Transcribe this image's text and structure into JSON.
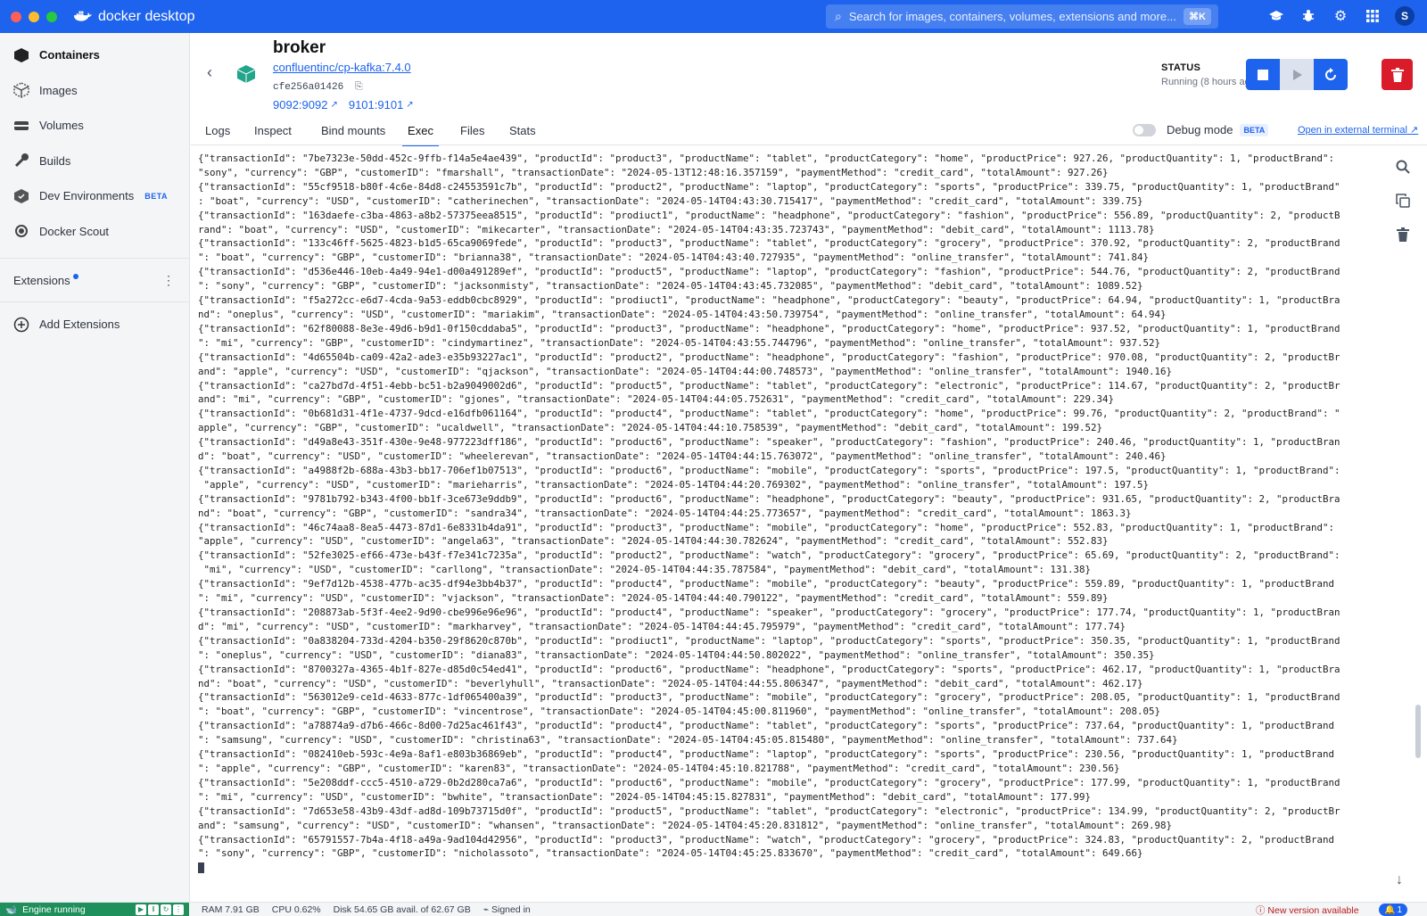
{
  "app": {
    "title": "docker desktop",
    "colors": {
      "brand": "#1d63ed",
      "danger": "#d91b2a",
      "running": "#1f8f5c"
    }
  },
  "search": {
    "placeholder": "Search for images, containers, volumes, extensions and more...",
    "shortcut": "⌘K"
  },
  "account": {
    "initial": "S"
  },
  "sidebar": {
    "items": [
      {
        "label": "Containers",
        "icon": "containers-icon",
        "active": true
      },
      {
        "label": "Images",
        "icon": "images-icon"
      },
      {
        "label": "Volumes",
        "icon": "volumes-icon"
      },
      {
        "label": "Builds",
        "icon": "builds-icon"
      },
      {
        "label": "Dev Environments",
        "icon": "dev-environments-icon",
        "badge": "BETA"
      },
      {
        "label": "Docker Scout",
        "icon": "docker-scout-icon"
      }
    ],
    "extensions_label": "Extensions",
    "add_extensions_label": "Add Extensions"
  },
  "container": {
    "name": "broker",
    "image": "confluentinc/cp-kafka:7.4.0",
    "id": "cfe256a01426",
    "ports": [
      "9092:9092",
      "9101:9101"
    ],
    "status_label": "STATUS",
    "status_value": "Running (8 hours ago)"
  },
  "tabs": [
    {
      "label": "Logs"
    },
    {
      "label": "Inspect"
    },
    {
      "label": "Bind mounts"
    },
    {
      "label": "Exec",
      "active": true
    },
    {
      "label": "Files"
    },
    {
      "label": "Stats"
    }
  ],
  "debug": {
    "label": "Debug mode",
    "badge": "BETA",
    "external_terminal": "Open in external terminal"
  },
  "terminal": {
    "lines": [
      "{\"transactionId\": \"7be7323e-50dd-452c-9ffb-f14a5e4ae439\", \"productId\": \"product3\", \"productName\": \"tablet\", \"productCategory\": \"home\", \"productPrice\": 927.26, \"productQuantity\": 1, \"productBrand\":",
      "\"sony\", \"currency\": \"GBP\", \"customerID\": \"fmarshall\", \"transactionDate\": \"2024-05-13T12:48:16.357159\", \"paymentMethod\": \"credit_card\", \"totalAmount\": 927.26}",
      "{\"transactionId\": \"55cf9518-b80f-4c6e-84d8-c24553591c7b\", \"productId\": \"product2\", \"productName\": \"laptop\", \"productCategory\": \"sports\", \"productPrice\": 339.75, \"productQuantity\": 1, \"productBrand\"",
      ": \"boat\", \"currency\": \"USD\", \"customerID\": \"catherinechen\", \"transactionDate\": \"2024-05-14T04:43:30.715417\", \"paymentMethod\": \"credit_card\", \"totalAmount\": 339.75}",
      "{\"transactionId\": \"163daefe-c3ba-4863-a8b2-57375eea8515\", \"productId\": \"prodiuct1\", \"productName\": \"headphone\", \"productCategory\": \"fashion\", \"productPrice\": 556.89, \"productQuantity\": 2, \"productB",
      "rand\": \"boat\", \"currency\": \"USD\", \"customerID\": \"mikecarter\", \"transactionDate\": \"2024-05-14T04:43:35.723743\", \"paymentMethod\": \"debit_card\", \"totalAmount\": 1113.78}",
      "{\"transactionId\": \"133c46ff-5625-4823-b1d5-65ca9069fede\", \"productId\": \"product3\", \"productName\": \"tablet\", \"productCategory\": \"grocery\", \"productPrice\": 370.92, \"productQuantity\": 2, \"productBrand",
      "\": \"boat\", \"currency\": \"GBP\", \"customerID\": \"brianna38\", \"transactionDate\": \"2024-05-14T04:43:40.727935\", \"paymentMethod\": \"online_transfer\", \"totalAmount\": 741.84}",
      "{\"transactionId\": \"d536e446-10eb-4a49-94e1-d00a491289ef\", \"productId\": \"product5\", \"productName\": \"laptop\", \"productCategory\": \"fashion\", \"productPrice\": 544.76, \"productQuantity\": 2, \"productBrand",
      "\": \"sony\", \"currency\": \"GBP\", \"customerID\": \"jacksonmisty\", \"transactionDate\": \"2024-05-14T04:43:45.732085\", \"paymentMethod\": \"debit_card\", \"totalAmount\": 1089.52}",
      "{\"transactionId\": \"f5a272cc-e6d7-4cda-9a53-eddb0cbc8929\", \"productId\": \"prodiuct1\", \"productName\": \"headphone\", \"productCategory\": \"beauty\", \"productPrice\": 64.94, \"productQuantity\": 1, \"productBra",
      "nd\": \"oneplus\", \"currency\": \"USD\", \"customerID\": \"mariakim\", \"transactionDate\": \"2024-05-14T04:43:50.739754\", \"paymentMethod\": \"online_transfer\", \"totalAmount\": 64.94}",
      "{\"transactionId\": \"62f80088-8e3e-49d6-b9d1-0f150cddaba5\", \"productId\": \"product3\", \"productName\": \"headphone\", \"productCategory\": \"home\", \"productPrice\": 937.52, \"productQuantity\": 1, \"productBrand",
      "\": \"mi\", \"currency\": \"GBP\", \"customerID\": \"cindymartinez\", \"transactionDate\": \"2024-05-14T04:43:55.744796\", \"paymentMethod\": \"online_transfer\", \"totalAmount\": 937.52}",
      "{\"transactionId\": \"4d65504b-ca09-42a2-ade3-e35b93227ac1\", \"productId\": \"product2\", \"productName\": \"headphone\", \"productCategory\": \"fashion\", \"productPrice\": 970.08, \"productQuantity\": 2, \"productBr",
      "and\": \"apple\", \"currency\": \"USD\", \"customerID\": \"qjackson\", \"transactionDate\": \"2024-05-14T04:44:00.748573\", \"paymentMethod\": \"online_transfer\", \"totalAmount\": 1940.16}",
      "{\"transactionId\": \"ca27bd7d-4f51-4ebb-bc51-b2a9049002d6\", \"productId\": \"product5\", \"productName\": \"tablet\", \"productCategory\": \"electronic\", \"productPrice\": 114.67, \"productQuantity\": 2, \"productBr",
      "and\": \"mi\", \"currency\": \"GBP\", \"customerID\": \"gjones\", \"transactionDate\": \"2024-05-14T04:44:05.752631\", \"paymentMethod\": \"credit_card\", \"totalAmount\": 229.34}",
      "{\"transactionId\": \"0b681d31-4f1e-4737-9dcd-e16dfb061164\", \"productId\": \"product4\", \"productName\": \"tablet\", \"productCategory\": \"home\", \"productPrice\": 99.76, \"productQuantity\": 2, \"productBrand\": \"",
      "apple\", \"currency\": \"GBP\", \"customerID\": \"ucaldwell\", \"transactionDate\": \"2024-05-14T04:44:10.758539\", \"paymentMethod\": \"debit_card\", \"totalAmount\": 199.52}",
      "{\"transactionId\": \"d49a8e43-351f-430e-9e48-977223dff186\", \"productId\": \"product6\", \"productName\": \"speaker\", \"productCategory\": \"fashion\", \"productPrice\": 240.46, \"productQuantity\": 1, \"productBran",
      "d\": \"boat\", \"currency\": \"USD\", \"customerID\": \"wheelerevan\", \"transactionDate\": \"2024-05-14T04:44:15.763072\", \"paymentMethod\": \"online_transfer\", \"totalAmount\": 240.46}",
      "{\"transactionId\": \"a4988f2b-688a-43b3-bb17-706ef1b07513\", \"productId\": \"product6\", \"productName\": \"mobile\", \"productCategory\": \"sports\", \"productPrice\": 197.5, \"productQuantity\": 1, \"productBrand\":",
      " \"apple\", \"currency\": \"USD\", \"customerID\": \"marieharris\", \"transactionDate\": \"2024-05-14T04:44:20.769302\", \"paymentMethod\": \"online_transfer\", \"totalAmount\": 197.5}",
      "{\"transactionId\": \"9781b792-b343-4f00-bb1f-3ce673e9ddb9\", \"productId\": \"product6\", \"productName\": \"headphone\", \"productCategory\": \"beauty\", \"productPrice\": 931.65, \"productQuantity\": 2, \"productBra",
      "nd\": \"boat\", \"currency\": \"GBP\", \"customerID\": \"sandra34\", \"transactionDate\": \"2024-05-14T04:44:25.773657\", \"paymentMethod\": \"credit_card\", \"totalAmount\": 1863.3}",
      "{\"transactionId\": \"46c74aa8-8ea5-4473-87d1-6e8331b4da91\", \"productId\": \"product3\", \"productName\": \"mobile\", \"productCategory\": \"home\", \"productPrice\": 552.83, \"productQuantity\": 1, \"productBrand\":",
      "\"apple\", \"currency\": \"USD\", \"customerID\": \"angela63\", \"transactionDate\": \"2024-05-14T04:44:30.782624\", \"paymentMethod\": \"credit_card\", \"totalAmount\": 552.83}",
      "{\"transactionId\": \"52fe3025-ef66-473e-b43f-f7e341c7235a\", \"productId\": \"product2\", \"productName\": \"watch\", \"productCategory\": \"grocery\", \"productPrice\": 65.69, \"productQuantity\": 2, \"productBrand\":",
      " \"mi\", \"currency\": \"USD\", \"customerID\": \"carllong\", \"transactionDate\": \"2024-05-14T04:44:35.787584\", \"paymentMethod\": \"debit_card\", \"totalAmount\": 131.38}",
      "{\"transactionId\": \"9ef7d12b-4538-477b-ac35-df94e3bb4b37\", \"productId\": \"product4\", \"productName\": \"mobile\", \"productCategory\": \"beauty\", \"productPrice\": 559.89, \"productQuantity\": 1, \"productBrand",
      "\": \"mi\", \"currency\": \"USD\", \"customerID\": \"vjackson\", \"transactionDate\": \"2024-05-14T04:44:40.790122\", \"paymentMethod\": \"credit_card\", \"totalAmount\": 559.89}",
      "{\"transactionId\": \"208873ab-5f3f-4ee2-9d90-cbe996e96e96\", \"productId\": \"product4\", \"productName\": \"speaker\", \"productCategory\": \"grocery\", \"productPrice\": 177.74, \"productQuantity\": 1, \"productBran",
      "d\": \"mi\", \"currency\": \"USD\", \"customerID\": \"markharvey\", \"transactionDate\": \"2024-05-14T04:44:45.795979\", \"paymentMethod\": \"credit_card\", \"totalAmount\": 177.74}",
      "{\"transactionId\": \"0a838204-733d-4204-b350-29f8620c870b\", \"productId\": \"prodiuct1\", \"productName\": \"laptop\", \"productCategory\": \"sports\", \"productPrice\": 350.35, \"productQuantity\": 1, \"productBrand",
      "\": \"oneplus\", \"currency\": \"USD\", \"customerID\": \"diana83\", \"transactionDate\": \"2024-05-14T04:44:50.802022\", \"paymentMethod\": \"online_transfer\", \"totalAmount\": 350.35}",
      "{\"transactionId\": \"8700327a-4365-4b1f-827e-d85d0c54ed41\", \"productId\": \"product6\", \"productName\": \"headphone\", \"productCategory\": \"sports\", \"productPrice\": 462.17, \"productQuantity\": 1, \"productBra",
      "nd\": \"boat\", \"currency\": \"USD\", \"customerID\": \"beverlyhull\", \"transactionDate\": \"2024-05-14T04:44:55.806347\", \"paymentMethod\": \"debit_card\", \"totalAmount\": 462.17}",
      "{\"transactionId\": \"563012e9-ce1d-4633-877c-1df065400a39\", \"productId\": \"product3\", \"productName\": \"mobile\", \"productCategory\": \"grocery\", \"productPrice\": 208.05, \"productQuantity\": 1, \"productBrand",
      "\": \"boat\", \"currency\": \"GBP\", \"customerID\": \"vincentrose\", \"transactionDate\": \"2024-05-14T04:45:00.811960\", \"paymentMethod\": \"online_transfer\", \"totalAmount\": 208.05}",
      "{\"transactionId\": \"a78874a9-d7b6-466c-8d00-7d25ac461f43\", \"productId\": \"product4\", \"productName\": \"tablet\", \"productCategory\": \"sports\", \"productPrice\": 737.64, \"productQuantity\": 1, \"productBrand",
      "\": \"samsung\", \"currency\": \"USD\", \"customerID\": \"christina63\", \"transactionDate\": \"2024-05-14T04:45:05.815480\", \"paymentMethod\": \"online_transfer\", \"totalAmount\": 737.64}",
      "{\"transactionId\": \"082410eb-593c-4e9a-8af1-e803b36869eb\", \"productId\": \"product4\", \"productName\": \"laptop\", \"productCategory\": \"sports\", \"productPrice\": 230.56, \"productQuantity\": 1, \"productBrand",
      "\": \"apple\", \"currency\": \"GBP\", \"customerID\": \"karen83\", \"transactionDate\": \"2024-05-14T04:45:10.821788\", \"paymentMethod\": \"credit_card\", \"totalAmount\": 230.56}",
      "{\"transactionId\": \"5e208ddf-ccc5-4510-a729-0b2d280ca7a6\", \"productId\": \"product6\", \"productName\": \"mobile\", \"productCategory\": \"grocery\", \"productPrice\": 177.99, \"productQuantity\": 1, \"productBrand",
      "\": \"mi\", \"currency\": \"USD\", \"customerID\": \"bwhite\", \"transactionDate\": \"2024-05-14T04:45:15.827831\", \"paymentMethod\": \"debit_card\", \"totalAmount\": 177.99}",
      "{\"transactionId\": \"7d653e58-43b9-43df-ad8d-109b73715d0f\", \"productId\": \"product5\", \"productName\": \"tablet\", \"productCategory\": \"electronic\", \"productPrice\": 134.99, \"productQuantity\": 2, \"productBr",
      "and\": \"samsung\", \"currency\": \"USD\", \"customerID\": \"whansen\", \"transactionDate\": \"2024-05-14T04:45:20.831812\", \"paymentMethod\": \"online_transfer\", \"totalAmount\": 269.98}",
      "{\"transactionId\": \"65791557-7b4a-4f18-a49a-9ad104d42956\", \"productId\": \"product3\", \"productName\": \"watch\", \"productCategory\": \"grocery\", \"productPrice\": 324.83, \"productQuantity\": 2, \"productBrand",
      "\": \"sony\", \"currency\": \"GBP\", \"customerID\": \"nicholassoto\", \"transactionDate\": \"2024-05-14T04:45:25.833670\", \"paymentMethod\": \"credit_card\", \"totalAmount\": 649.66}"
    ]
  },
  "footer": {
    "engine": "Engine running",
    "ram": "RAM 7.91 GB",
    "cpu": "CPU 0.62%",
    "disk": "Disk 54.65 GB avail. of 62.67 GB",
    "signed_in": "Signed in",
    "new_version": "New version available",
    "notifications": "1"
  }
}
